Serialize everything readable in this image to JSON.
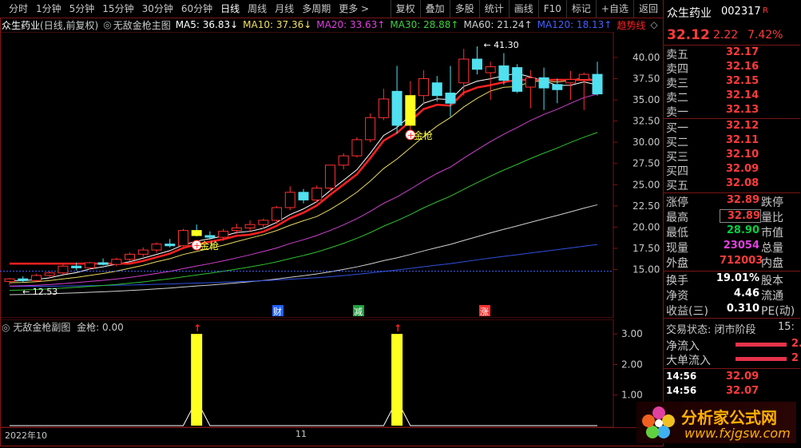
{
  "topbar": {
    "periods": [
      "分时",
      "1分钟",
      "5分钟",
      "15分钟",
      "30分钟",
      "60分钟",
      "日线",
      "周线",
      "月线",
      "多周期",
      "更多 >"
    ],
    "active": "日线",
    "tools": [
      "复权",
      "叠加",
      "多股",
      "统计",
      "画线",
      "F10",
      "标记",
      "+自选",
      "返回"
    ]
  },
  "title": {
    "stock": "众生药业",
    "mode": "(日线,前复权)",
    "indicator": "无敌金枪主图",
    "ma5": "MA5: 36.83↓",
    "ma10": "MA10: 37.36↓",
    "ma20": "MA20: 33.63↑",
    "ma30": "MA30: 28.88↑",
    "ma60": "MA60: 21.24↑",
    "ma120": "MA120: 18.13↑",
    "trend": "趋势线",
    "colors": {
      "ma5": "#ffffff",
      "ma10": "#f0e060",
      "ma20": "#e040e0",
      "ma30": "#40d040",
      "ma60": "#d0d0d0",
      "ma120": "#4060ff",
      "trend": "#ff2020"
    }
  },
  "main": {
    "ylabels": [
      "40.00",
      "37.50",
      "35.00",
      "32.50",
      "30.00",
      "27.50",
      "25.00",
      "22.50",
      "20.00",
      "17.50",
      "15.00"
    ],
    "high_label": "41.30",
    "low_label": "12.53",
    "signal_label": "金枪",
    "events": [
      "财",
      "减",
      "涨"
    ]
  },
  "sub": {
    "title": "无敌金枪副图",
    "value": "金枪: 0.00",
    "ylabels": [
      "3.00",
      "2.00",
      "1.00"
    ]
  },
  "timeaxis": {
    "start": "2022年10",
    "mid": "11"
  },
  "quote": {
    "name": "众生药业",
    "code": "002317",
    "flag": "R",
    "price": "32.12",
    "change": "2.22",
    "pct": "7.42%",
    "asks": [
      {
        "label": "卖五",
        "price": "32.17"
      },
      {
        "label": "卖四",
        "price": "32.16"
      },
      {
        "label": "卖三",
        "price": "32.15"
      },
      {
        "label": "卖二",
        "price": "32.14"
      },
      {
        "label": "卖一",
        "price": "32.13"
      }
    ],
    "bids": [
      {
        "label": "买一",
        "price": "32.12"
      },
      {
        "label": "买二",
        "price": "32.11"
      },
      {
        "label": "买三",
        "price": "32.10"
      },
      {
        "label": "买四",
        "price": "32.09"
      },
      {
        "label": "买五",
        "price": "32.08"
      }
    ],
    "stats": [
      {
        "l1": "涨停",
        "v1": "32.89",
        "l2": "跌停",
        "c": "#ff3b3b"
      },
      {
        "l1": "最高",
        "v1": "32.89",
        "l2": "量比",
        "c": "#ff3b3b",
        "boxed": true
      },
      {
        "l1": "最低",
        "v1": "28.90",
        "l2": "市值",
        "c": "#00d040"
      },
      {
        "l1": "现量",
        "v1": "23054",
        "l2": "总量",
        "c": "#e040e0"
      },
      {
        "l1": "外盘",
        "v1": "712003",
        "l2": "内盘",
        "c": "#ff3b3b"
      }
    ],
    "stats2": [
      {
        "l1": "换手",
        "v1": "19.01%",
        "l2": "股本"
      },
      {
        "l1": "净资",
        "v1": "4.46",
        "l2": "流通"
      },
      {
        "l1": "收益(三)",
        "v1": "0.310",
        "l2": "PE(动)"
      }
    ],
    "trade_status": "交易状态: 闭市阶段",
    "trade_time": "15:",
    "flows": [
      {
        "label": "净流入",
        "v": "2."
      },
      {
        "label": "大单流入",
        "v": "2"
      }
    ],
    "ticks": [
      {
        "t": "14:56",
        "p": "32.09"
      },
      {
        "t": "14:56",
        "p": "32.07"
      }
    ]
  },
  "watermark": {
    "cn": "分析家公式网",
    "url": "www.fxjgsw.com"
  },
  "chart_data": {
    "type": "candlestick",
    "title": "",
    "ylim": [
      11,
      43
    ],
    "candles": [
      [
        13.6,
        14.0,
        13.2,
        13.9
      ],
      [
        13.9,
        14.2,
        13.5,
        13.7
      ],
      [
        13.7,
        14.5,
        13.6,
        14.3
      ],
      [
        14.3,
        14.8,
        14.0,
        14.6
      ],
      [
        14.6,
        15.6,
        14.4,
        15.4
      ],
      [
        15.4,
        15.8,
        14.9,
        15.2
      ],
      [
        15.2,
        15.9,
        15.0,
        15.8
      ],
      [
        15.8,
        16.3,
        15.5,
        15.6
      ],
      [
        15.6,
        16.4,
        15.4,
        16.2
      ],
      [
        16.2,
        17.0,
        16.0,
        16.8
      ],
      [
        16.8,
        17.6,
        16.5,
        17.3
      ],
      [
        17.3,
        18.2,
        17.0,
        18.0
      ],
      [
        18.0,
        18.6,
        17.6,
        17.8
      ],
      [
        17.8,
        19.8,
        17.7,
        19.6
      ],
      [
        19.6,
        20.3,
        18.9,
        19.0
      ],
      [
        19.0,
        19.5,
        18.5,
        18.8
      ],
      [
        18.8,
        19.8,
        18.4,
        19.5
      ],
      [
        19.6,
        20.4,
        19.2,
        19.9
      ],
      [
        19.9,
        20.8,
        19.5,
        20.3
      ],
      [
        20.3,
        21.0,
        19.8,
        20.8
      ],
      [
        20.8,
        22.5,
        20.4,
        22.3
      ],
      [
        22.3,
        24.8,
        22.0,
        24.1
      ],
      [
        24.1,
        24.5,
        22.8,
        23.2
      ],
      [
        23.2,
        24.9,
        22.9,
        24.6
      ],
      [
        24.6,
        26.5,
        24.2,
        27.3
      ],
      [
        27.3,
        28.7,
        26.8,
        28.4
      ],
      [
        28.4,
        30.6,
        28.2,
        30.3
      ],
      [
        30.3,
        33.4,
        30.0,
        32.9
      ],
      [
        32.9,
        36.3,
        32.6,
        35.1
      ],
      [
        36.0,
        39.0,
        31.0,
        32.0
      ],
      [
        32.0,
        37.2,
        31.0,
        35.5
      ],
      [
        35.5,
        38.5,
        34.5,
        37.5
      ],
      [
        37.0,
        37.8,
        34.8,
        35.5
      ],
      [
        35.8,
        39.0,
        33.0,
        34.6
      ],
      [
        37.0,
        41.0,
        35.5,
        39.8
      ],
      [
        39.8,
        41.3,
        38.0,
        38.6
      ],
      [
        38.2,
        39.5,
        35.0,
        38.9
      ],
      [
        39.0,
        40.5,
        36.8,
        37.3
      ],
      [
        38.8,
        39.2,
        35.8,
        36.0
      ],
      [
        36.5,
        38.5,
        34.0,
        37.6
      ],
      [
        37.6,
        38.8,
        33.8,
        36.4
      ],
      [
        36.8,
        37.5,
        34.6,
        36.2
      ],
      [
        37.0,
        38.4,
        35.0,
        37.4
      ],
      [
        37.4,
        38.2,
        33.8,
        38.0
      ],
      [
        38.0,
        39.5,
        35.5,
        35.7
      ]
    ],
    "signal_days": [
      14,
      30
    ],
    "sub_series": {
      "name": "金枪",
      "values": [
        0,
        0,
        0,
        0,
        0,
        0,
        0,
        0,
        0,
        0,
        0,
        0,
        0,
        0,
        3,
        0,
        0,
        0,
        0,
        0,
        0,
        0,
        0,
        0,
        0,
        0,
        0,
        0,
        0,
        3,
        0,
        0,
        0,
        0,
        0,
        0,
        0,
        0,
        0,
        0,
        0,
        0,
        0,
        0,
        0
      ]
    }
  }
}
